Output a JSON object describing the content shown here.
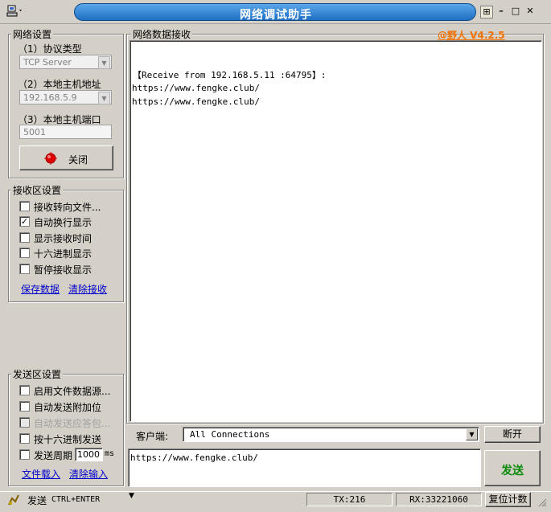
{
  "window": {
    "title": "网络调试助手",
    "version_label": "@野人 V4.2.5"
  },
  "network": {
    "group_title": "网络设置",
    "protocol_label": "（1）协议类型",
    "protocol_value": "TCP Server",
    "host_label": "（2）本地主机地址",
    "host_value": "192.168.5.9",
    "port_label": "（3）本地主机端口",
    "port_value": "5001",
    "close_button": "关闭"
  },
  "receive_settings": {
    "group_title": "接收区设置",
    "options": [
      {
        "label": "接收转向文件...",
        "checked": false
      },
      {
        "label": "自动换行显示",
        "checked": true
      },
      {
        "label": "显示接收时间",
        "checked": false
      },
      {
        "label": "十六进制显示",
        "checked": false
      },
      {
        "label": "暂停接收显示",
        "checked": false
      }
    ],
    "save_link": "保存数据",
    "clear_link": "清除接收"
  },
  "send_settings": {
    "group_title": "发送区设置",
    "options": [
      {
        "label": "启用文件数据源...",
        "checked": false,
        "disabled": false
      },
      {
        "label": "自动发送附加位",
        "checked": false,
        "disabled": false
      },
      {
        "label": "自动发送应答包...",
        "checked": false,
        "disabled": true
      },
      {
        "label": "按十六进制发送",
        "checked": false,
        "disabled": false
      },
      {
        "label": "发送周期",
        "checked": false,
        "disabled": false
      }
    ],
    "period_value": "1000",
    "period_unit": "ms",
    "load_file_link": "文件载入",
    "clear_input_link": "清除输入"
  },
  "receive_area": {
    "group_title": "网络数据接收",
    "lines": [
      "【Receive from 192.168.5.11 :64795】:",
      "https://www.fengke.club/",
      "https://www.fengke.club/"
    ]
  },
  "client_bar": {
    "label": "客户端:",
    "value": "All Connections",
    "disconnect_button": "断开"
  },
  "send_area": {
    "text": "https://www.fengke.club/",
    "send_button": "发送"
  },
  "status_bar": {
    "send_hint": "发送",
    "shortcut": "CTRL+ENTER",
    "tx": "TX:216",
    "rx": "RX:33221060",
    "reset_button": "复位计数"
  },
  "colors": {
    "accent_orange": "#f07000",
    "title_blue": "#1f6fc4",
    "send_green": "#0a8a0a"
  }
}
